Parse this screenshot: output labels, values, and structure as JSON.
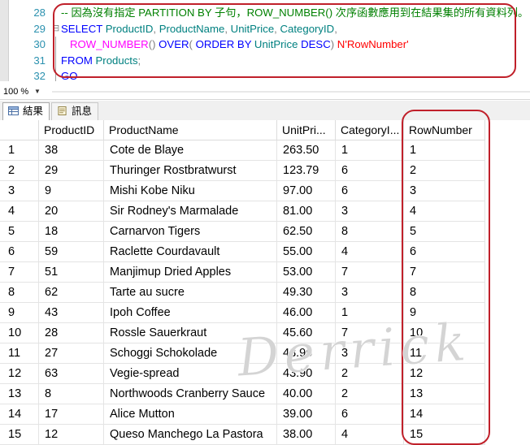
{
  "editor": {
    "lines": [
      {
        "num": "28",
        "tokens": [
          {
            "c": "cm",
            "t": "-- 因為沒有指定 PARTITION BY 子句，ROW_NUMBER() 次序函數應用到在結果集的所有資料列。"
          }
        ]
      },
      {
        "num": "29",
        "tokens": [
          {
            "c": "kw",
            "t": "SELECT "
          },
          {
            "c": "id",
            "t": "ProductID"
          },
          {
            "c": "pl",
            "t": ", "
          },
          {
            "c": "id",
            "t": "ProductName"
          },
          {
            "c": "pl",
            "t": ", "
          },
          {
            "c": "id",
            "t": "UnitPrice"
          },
          {
            "c": "pl",
            "t": ", "
          },
          {
            "c": "id",
            "t": "CategoryID"
          },
          {
            "c": "pl",
            "t": ","
          }
        ]
      },
      {
        "num": "30",
        "tokens": [
          {
            "c": "pl",
            "t": "   "
          },
          {
            "c": "fn",
            "t": "ROW_NUMBER"
          },
          {
            "c": "pl",
            "t": "() "
          },
          {
            "c": "kw",
            "t": "OVER"
          },
          {
            "c": "pl",
            "t": "( "
          },
          {
            "c": "kw",
            "t": "ORDER BY "
          },
          {
            "c": "id",
            "t": "UnitPrice "
          },
          {
            "c": "kw",
            "t": "DESC"
          },
          {
            "c": "pl",
            "t": ") "
          },
          {
            "c": "str",
            "t": "N'RowNumber'"
          }
        ]
      },
      {
        "num": "31",
        "tokens": [
          {
            "c": "kw",
            "t": "FROM "
          },
          {
            "c": "id",
            "t": "Products"
          },
          {
            "c": "pl",
            "t": ";"
          }
        ]
      },
      {
        "num": "32",
        "tokens": [
          {
            "c": "kw",
            "t": "GO"
          }
        ]
      }
    ]
  },
  "zoom": {
    "value": "100 %"
  },
  "tabs": {
    "results_label": "結果",
    "messages_label": "訊息"
  },
  "grid": {
    "columns": [
      "",
      "ProductID",
      "ProductName",
      "UnitPri...",
      "CategoryI...",
      "RowNumber"
    ],
    "rows": [
      [
        "1",
        "38",
        "Cote de Blaye",
        "263.50",
        "1",
        "1"
      ],
      [
        "2",
        "29",
        "Thuringer Rostbratwurst",
        "123.79",
        "6",
        "2"
      ],
      [
        "3",
        "9",
        "Mishi Kobe Niku",
        "97.00",
        "6",
        "3"
      ],
      [
        "4",
        "20",
        "Sir Rodney's Marmalade",
        "81.00",
        "3",
        "4"
      ],
      [
        "5",
        "18",
        "Carnarvon Tigers",
        "62.50",
        "8",
        "5"
      ],
      [
        "6",
        "59",
        "Raclette Courdavault",
        "55.00",
        "4",
        "6"
      ],
      [
        "7",
        "51",
        "Manjimup Dried Apples",
        "53.00",
        "7",
        "7"
      ],
      [
        "8",
        "62",
        "Tarte au sucre",
        "49.30",
        "3",
        "8"
      ],
      [
        "9",
        "43",
        "Ipoh Coffee",
        "46.00",
        "1",
        "9"
      ],
      [
        "10",
        "28",
        "Rossle Sauerkraut",
        "45.60",
        "7",
        "10"
      ],
      [
        "11",
        "27",
        "Schoggi Schokolade",
        "43.90",
        "3",
        "11"
      ],
      [
        "12",
        "63",
        "Vegie-spread",
        "43.90",
        "2",
        "12"
      ],
      [
        "13",
        "8",
        "Northwoods Cranberry Sauce",
        "40.00",
        "2",
        "13"
      ],
      [
        "14",
        "17",
        "Alice Mutton",
        "39.00",
        "6",
        "14"
      ],
      [
        "15",
        "12",
        "Queso Manchego La Pastora",
        "38.00",
        "4",
        "15"
      ]
    ]
  },
  "watermark": {
    "text": "Derrick"
  },
  "colors": {
    "highlight": "#c0202a",
    "keyword": "#0000ff",
    "function": "#ff00ff",
    "string": "#ff0000",
    "comment": "#008000",
    "identifier": "#008080",
    "line_number": "#2b91af"
  }
}
